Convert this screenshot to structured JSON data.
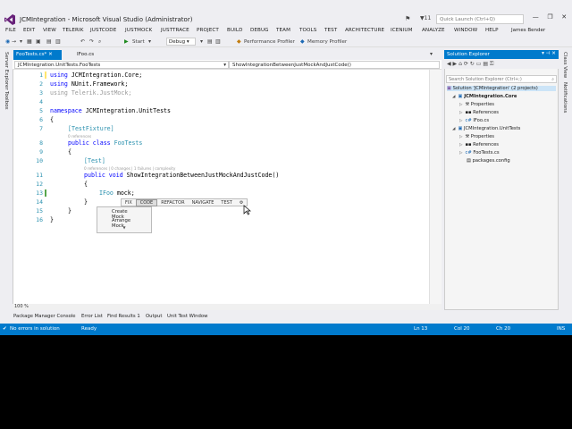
{
  "window": {
    "title": "JCMIntegration - Microsoft Visual Studio (Administrator)",
    "notif_count": "11",
    "quick_launch_placeholder": "Quick Launch (Ctrl+Q)"
  },
  "menu": [
    "FILE",
    "EDIT",
    "VIEW",
    "TELERIK",
    "JUSTCODE",
    "JUSTMOCK",
    "JUSTTRACE",
    "PROJECT",
    "BUILD",
    "DEBUG",
    "TEAM",
    "TOOLS",
    "TEST",
    "ARCHITECTURE",
    "ICENIUM",
    "ANALYZE",
    "WINDOW",
    "HELP"
  ],
  "user": "James Bender",
  "toolbar": {
    "start_label": "Start",
    "config": "Debug",
    "perf_profiler": "Performance Profiler",
    "mem_profiler": "Memory Profiler"
  },
  "left_rail": {
    "server_explorer": "Server Explorer",
    "toolbox": "Toolbox"
  },
  "right_rail": {
    "class_view": "Class View",
    "notifications": "Notifications"
  },
  "tabs": {
    "active": "FooTests.cs*",
    "other": "IFoo.cs"
  },
  "navbar": {
    "class_dd": "JCMIntegration.UnitTests.FooTests",
    "member_dd": "ShowIntegrationBetweenJustMockAndJustCode()"
  },
  "code": {
    "l1_kw": "using",
    "l1_rest": " JCMIntegration.Core;",
    "l2_kw": "using",
    "l2_rest": " NUnit.Framework;",
    "l3": "using Telerik.JustMock;",
    "l5_kw": "namespace",
    "l5_rest": " JCMIntegration.UnitTests",
    "l6": "{",
    "l7": "[TestFixture]",
    "lens7": "0 references",
    "l8_kw": "public class",
    "l8_ty": " FooTests",
    "l9": "{",
    "l10": "[Test]",
    "lens10": "0 references | 0 changes | 1 failures | complexity",
    "l11_kw": "public void",
    "l11_rest": " ShowIntegrationBetweenJustMockAndJustCode()",
    "l12": "{",
    "l13_ty": "IFoo",
    "l13_rest": " mock;",
    "l14": "}",
    "l15": "}",
    "l16": "}"
  },
  "line_numbers": [
    "1",
    "2",
    "3",
    "4",
    "5",
    "6",
    "7",
    "8",
    "9",
    "10",
    "11",
    "12",
    "13",
    "14",
    "15",
    "16"
  ],
  "zoom": "100 %",
  "justmock_bar": {
    "fix": "FIX",
    "code": "CODE",
    "refactor": "REFACTOR",
    "navigate": "NAVIGATE",
    "test": "TEST"
  },
  "justmock_menu": {
    "create": "Create Mock",
    "arrange": "Arrange Mock"
  },
  "solution": {
    "header": "Solution Explorer",
    "search": "Search Solution Explorer (Ctrl+;)",
    "root": "Solution 'JCMIntegration' (2 projects)",
    "core": "JCMIntegration.Core",
    "core_props": "Properties",
    "core_refs": "References",
    "core_ifoo": "IFoo.cs",
    "tests": "JCMIntegration.UnitTests",
    "tests_props": "Properties",
    "tests_refs": "References",
    "tests_foo": "FooTests.cs",
    "tests_pkgs": "packages.config"
  },
  "bottom_tabs": [
    "Package Manager Console",
    "Error List",
    "Find Results 1",
    "Output",
    "Unit Test Window"
  ],
  "status": {
    "errors": "No errors in solution",
    "ready": "Ready",
    "ln": "Ln 13",
    "col": "Col 20",
    "ch": "Ch 20",
    "ins": "INS"
  },
  "colors": {
    "accent": "#007acc",
    "keyword": "#0000ff",
    "type": "#2b91af"
  }
}
